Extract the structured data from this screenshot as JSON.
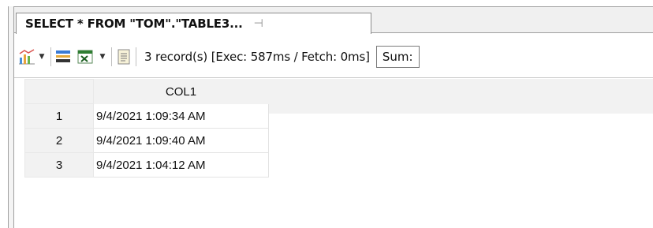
{
  "tab": {
    "title": "SELECT * FROM \"TOM\".\"TABLE3...",
    "pin_glyph": "⊣"
  },
  "toolbar": {
    "icons": [
      "chart-icon",
      "export-icon",
      "excel-icon",
      "notes-icon"
    ],
    "status": "3 record(s) [Exec: 587ms / Fetch: 0ms]",
    "sum_label": "Sum:"
  },
  "grid": {
    "columns": [
      "COL1"
    ],
    "rows": [
      {
        "num": "1",
        "col1": "9/4/2021 1:09:34 AM"
      },
      {
        "num": "2",
        "col1": "9/4/2021 1:09:40 AM"
      },
      {
        "num": "3",
        "col1": "9/4/2021 1:04:12 AM"
      }
    ]
  }
}
